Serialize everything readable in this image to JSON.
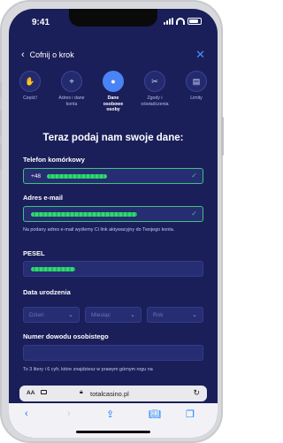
{
  "status_bar": {
    "time": "9:41"
  },
  "header": {
    "back_label": "Cofnij o krok"
  },
  "steps": [
    {
      "label": "Część!",
      "icon": "hand-wave-icon",
      "glyph": "✋"
    },
    {
      "label": "Adres i dane konta",
      "icon": "location-pin-icon",
      "glyph": "⌖"
    },
    {
      "label": "Dane osobowe osoby",
      "icon": "person-icon",
      "glyph": "●"
    },
    {
      "label": "Zgody i oświadczenia",
      "icon": "tools-icon",
      "glyph": "✂"
    },
    {
      "label": "Limity",
      "icon": "wallet-icon",
      "glyph": "▤"
    }
  ],
  "active_step": 2,
  "form": {
    "title": "Teraz podaj nam swoje dane:",
    "phone": {
      "label": "Telefon komórkowy",
      "prefix": "+48"
    },
    "email": {
      "label": "Adres e-mail",
      "hint": "Na podany adres e-mail wyślemy Ci link aktywacyjny do Twojego konta."
    },
    "pesel": {
      "label": "PESEL"
    },
    "dob": {
      "label": "Data urodzenia",
      "day_placeholder": "Dzień",
      "month_placeholder": "Miesiąc",
      "year_placeholder": "Rok"
    },
    "id_number": {
      "label": "Numer dowodu osobistego",
      "hint": "To 3 litery i 6 cyfr, które znajdziesz w prawym górnym rogu na"
    }
  },
  "browser": {
    "aa_label": "AA",
    "url": "totalcasino.pl"
  },
  "colors": {
    "background": "#1a1f5a",
    "accent": "#4a83f5",
    "valid": "#41c27a"
  }
}
